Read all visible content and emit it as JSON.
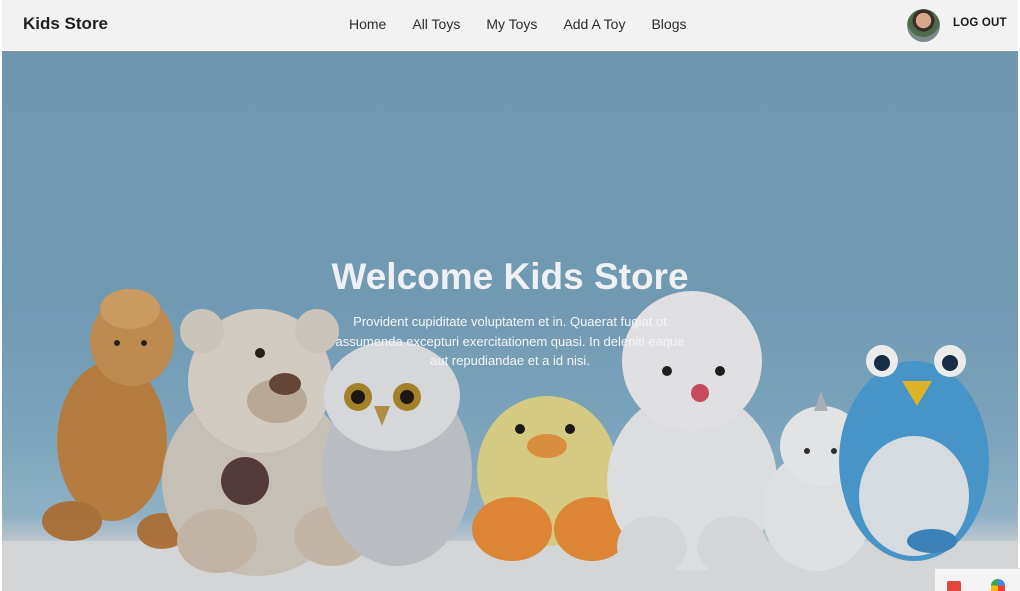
{
  "navbar": {
    "brand": "Kids Store",
    "links": [
      "Home",
      "All Toys",
      "My Toys",
      "Add A Toy",
      "Blogs"
    ],
    "logout_label": "LOG OUT"
  },
  "hero": {
    "title": "Welcome Kids Store",
    "text": "Provident cupiditate voluptatem et in. Quaerat fugiat ut assumenda excepturi exercitationem quasi. In deleniti eaque aut repudiandae et a id nisi."
  },
  "colors": {
    "navbar_bg": "#f2f2f2",
    "hero_blue": "#7aa4bf"
  },
  "icons": {
    "avatar": "user-avatar",
    "ext_1": "extension-icon",
    "ext_2": "extension-icon"
  }
}
